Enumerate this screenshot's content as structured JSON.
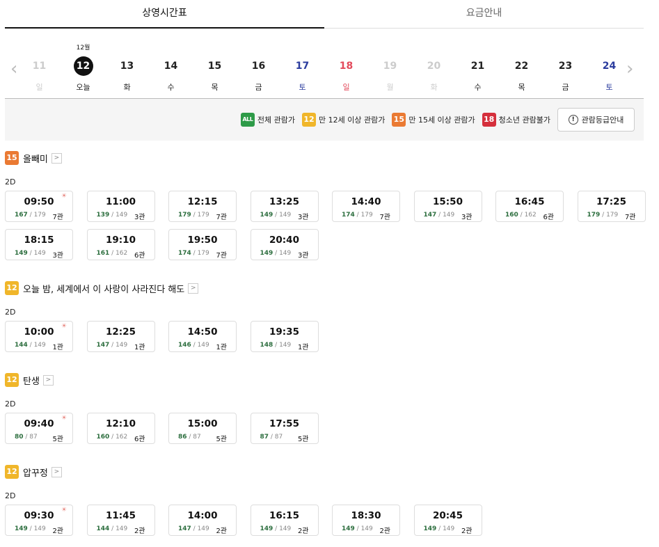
{
  "tabs": [
    {
      "label": "상영시간표",
      "active": true
    },
    {
      "label": "요금안내",
      "active": false
    }
  ],
  "dates": {
    "month_label": "12월",
    "days": [
      {
        "num": "11",
        "dow": "일",
        "tone": "dis"
      },
      {
        "num": "12",
        "dow": "오늘",
        "tone": "n",
        "selected": true
      },
      {
        "num": "13",
        "dow": "화",
        "tone": "n"
      },
      {
        "num": "14",
        "dow": "수",
        "tone": "n"
      },
      {
        "num": "15",
        "dow": "목",
        "tone": "n"
      },
      {
        "num": "16",
        "dow": "금",
        "tone": "n"
      },
      {
        "num": "17",
        "dow": "토",
        "tone": "sat"
      },
      {
        "num": "18",
        "dow": "일",
        "tone": "sun"
      },
      {
        "num": "19",
        "dow": "월",
        "tone": "dis"
      },
      {
        "num": "20",
        "dow": "화",
        "tone": "dis"
      },
      {
        "num": "21",
        "dow": "수",
        "tone": "n"
      },
      {
        "num": "22",
        "dow": "목",
        "tone": "n"
      },
      {
        "num": "23",
        "dow": "금",
        "tone": "n"
      },
      {
        "num": "24",
        "dow": "토",
        "tone": "sat"
      }
    ]
  },
  "legend": {
    "items": [
      {
        "badge": "ALL",
        "label": "전체 관람가",
        "color": "#2e9b48"
      },
      {
        "badge": "12",
        "label": "만 12세 이상 관람가",
        "color": "#f0b62a"
      },
      {
        "badge": "15",
        "label": "만 15세 이상 관람가",
        "color": "#ea7a33"
      },
      {
        "badge": "18",
        "label": "청소년 관람불가",
        "color": "#d52f3c"
      }
    ],
    "info_button": "관람등급안내",
    "info_icon_glyph": "!"
  },
  "movies": [
    {
      "rating": "15",
      "title": "올빼미",
      "format": "2D",
      "slots": [
        {
          "time": "09:50",
          "avail": "167",
          "total": "179",
          "hall": "7관",
          "morning": true
        },
        {
          "time": "11:00",
          "avail": "139",
          "total": "149",
          "hall": "3관"
        },
        {
          "time": "12:15",
          "avail": "179",
          "total": "179",
          "hall": "7관"
        },
        {
          "time": "13:25",
          "avail": "149",
          "total": "149",
          "hall": "3관"
        },
        {
          "time": "14:40",
          "avail": "174",
          "total": "179",
          "hall": "7관"
        },
        {
          "time": "15:50",
          "avail": "147",
          "total": "149",
          "hall": "3관"
        },
        {
          "time": "16:45",
          "avail": "160",
          "total": "162",
          "hall": "6관"
        },
        {
          "time": "17:25",
          "avail": "179",
          "total": "179",
          "hall": "7관"
        },
        {
          "time": "18:15",
          "avail": "149",
          "total": "149",
          "hall": "3관"
        },
        {
          "time": "19:10",
          "avail": "161",
          "total": "162",
          "hall": "6관"
        },
        {
          "time": "19:50",
          "avail": "174",
          "total": "179",
          "hall": "7관"
        },
        {
          "time": "20:40",
          "avail": "149",
          "total": "149",
          "hall": "3관"
        }
      ]
    },
    {
      "rating": "12",
      "title": "오늘 밤, 세계에서 이 사랑이 사라진다 해도",
      "format": "2D",
      "slots": [
        {
          "time": "10:00",
          "avail": "144",
          "total": "149",
          "hall": "1관",
          "morning": true
        },
        {
          "time": "12:25",
          "avail": "147",
          "total": "149",
          "hall": "1관"
        },
        {
          "time": "14:50",
          "avail": "146",
          "total": "149",
          "hall": "1관"
        },
        {
          "time": "19:35",
          "avail": "148",
          "total": "149",
          "hall": "1관"
        }
      ]
    },
    {
      "rating": "12",
      "title": "탄생",
      "format": "2D",
      "slots": [
        {
          "time": "09:40",
          "avail": "80",
          "total": "87",
          "hall": "5관",
          "morning": true
        },
        {
          "time": "12:10",
          "avail": "160",
          "total": "162",
          "hall": "6관"
        },
        {
          "time": "15:00",
          "avail": "86",
          "total": "87",
          "hall": "5관"
        },
        {
          "time": "17:55",
          "avail": "87",
          "total": "87",
          "hall": "5관"
        }
      ]
    },
    {
      "rating": "12",
      "title": "압꾸정",
      "format": "2D",
      "slots": [
        {
          "time": "09:30",
          "avail": "149",
          "total": "149",
          "hall": "2관",
          "morning": true
        },
        {
          "time": "11:45",
          "avail": "144",
          "total": "149",
          "hall": "2관"
        },
        {
          "time": "14:00",
          "avail": "147",
          "total": "149",
          "hall": "2관"
        },
        {
          "time": "16:15",
          "avail": "149",
          "total": "149",
          "hall": "2관"
        },
        {
          "time": "18:30",
          "avail": "149",
          "total": "149",
          "hall": "2관"
        },
        {
          "time": "20:45",
          "avail": "149",
          "total": "149",
          "hall": "2관"
        }
      ]
    }
  ]
}
